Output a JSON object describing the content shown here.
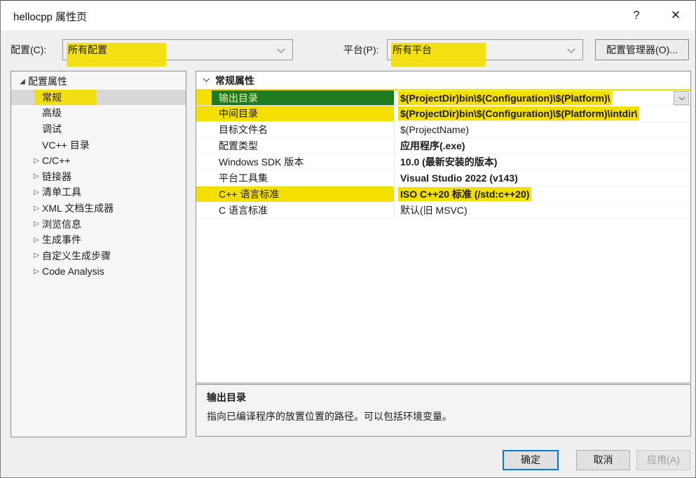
{
  "window": {
    "title": "hellocpp 属性页"
  },
  "icons": {
    "help": "?",
    "close": "✕",
    "tree_expanded": "◢",
    "tree_collapsed": "▷"
  },
  "toolbar": {
    "config_label": "配置(C):",
    "config_value": "所有配置",
    "platform_label": "平台(P):",
    "platform_value": "所有平台",
    "config_manager_button": "配置管理器(O)..."
  },
  "tree": {
    "items": [
      {
        "label": "配置属性",
        "level": 0,
        "expanded": true
      },
      {
        "label": "常规",
        "level": 1,
        "selected": true,
        "highlighted": true
      },
      {
        "label": "高级",
        "level": 1
      },
      {
        "label": "调试",
        "level": 1
      },
      {
        "label": "VC++ 目录",
        "level": 1
      },
      {
        "label": "C/C++",
        "level": 1,
        "collapsed_group": true
      },
      {
        "label": "链接器",
        "level": 1,
        "collapsed_group": true
      },
      {
        "label": "清单工具",
        "level": 1,
        "collapsed_group": true
      },
      {
        "label": "XML 文档生成器",
        "level": 1,
        "collapsed_group": true
      },
      {
        "label": "浏览信息",
        "level": 1,
        "collapsed_group": true
      },
      {
        "label": "生成事件",
        "level": 1,
        "collapsed_group": true
      },
      {
        "label": "自定义生成步骤",
        "level": 1,
        "collapsed_group": true
      },
      {
        "label": "Code Analysis",
        "level": 1,
        "collapsed_group": true
      }
    ]
  },
  "grid": {
    "section_header": "常规属性",
    "rows": [
      {
        "name": "输出目录",
        "value": "$(ProjectDir)bin\\$(Configuration)\\$(Platform)\\",
        "selected": true,
        "highlighted": true,
        "has_dropdown": true,
        "bold_value": true
      },
      {
        "name": "中间目录",
        "value": "$(ProjectDir)bin\\$(Configuration)\\$(Platform)\\intdir\\",
        "highlighted": true,
        "bold_value": true
      },
      {
        "name": "目标文件名",
        "value": "$(ProjectName)",
        "bold_value": false
      },
      {
        "name": "配置类型",
        "value": "应用程序(.exe)",
        "bold_value": true
      },
      {
        "name": "Windows SDK 版本",
        "value": "10.0 (最新安装的版本)",
        "bold_value": true
      },
      {
        "name": "平台工具集",
        "value": "Visual Studio 2022 (v143)",
        "bold_value": true
      },
      {
        "name": "C++ 语言标准",
        "value": "ISO C++20 标准 (/std:c++20)",
        "highlighted": true,
        "bold_value": true
      },
      {
        "name": "C 语言标准",
        "value": "默认(旧 MSVC)",
        "bold_value": false
      }
    ]
  },
  "description": {
    "title": "输出目录",
    "text": "指向已编译程序的放置位置的路径。可以包括环境变量。"
  },
  "footer": {
    "ok": "确定",
    "cancel": "取消",
    "apply": "应用(A)",
    "apply_enabled": false
  },
  "colors": {
    "highlight_yellow": "#f3e000",
    "selection_green": "#1e7b1e",
    "accent_blue": "#0078d7",
    "dialog_bg": "#f0f0f0"
  }
}
